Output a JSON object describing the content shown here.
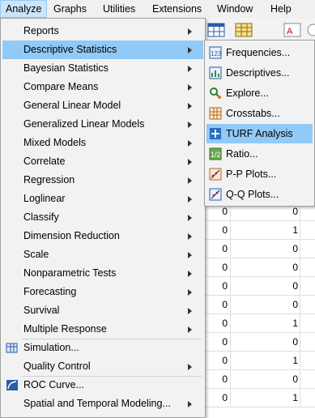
{
  "menubar": {
    "items": [
      {
        "label": "Analyze",
        "active": true
      },
      {
        "label": "Graphs"
      },
      {
        "label": "Utilities"
      },
      {
        "label": "Extensions"
      },
      {
        "label": "Window"
      },
      {
        "label": "Help"
      }
    ]
  },
  "analyze_menu": {
    "items": [
      {
        "label": "Reports",
        "submenu": true
      },
      {
        "label": "Descriptive Statistics",
        "submenu": true,
        "selected": true
      },
      {
        "label": "Bayesian Statistics",
        "submenu": true
      },
      {
        "label": "Compare Means",
        "submenu": true
      },
      {
        "label": "General Linear Model",
        "submenu": true
      },
      {
        "label": "Generalized Linear Models",
        "submenu": true
      },
      {
        "label": "Mixed Models",
        "submenu": true
      },
      {
        "label": "Correlate",
        "submenu": true
      },
      {
        "label": "Regression",
        "submenu": true
      },
      {
        "label": "Loglinear",
        "submenu": true
      },
      {
        "label": "Classify",
        "submenu": true
      },
      {
        "label": "Dimension Reduction",
        "submenu": true
      },
      {
        "label": "Scale",
        "submenu": true
      },
      {
        "label": "Nonparametric Tests",
        "submenu": true
      },
      {
        "label": "Forecasting",
        "submenu": true
      },
      {
        "label": "Survival",
        "submenu": true
      },
      {
        "label": "Multiple Response",
        "submenu": true
      },
      {
        "label": "Simulation...",
        "icon": "simulation-icon"
      },
      {
        "label": "Quality Control",
        "submenu": true
      },
      {
        "label": "ROC Curve...",
        "icon": "roc-curve-icon"
      },
      {
        "label": "Spatial and Temporal Modeling...",
        "submenu": true
      }
    ]
  },
  "descriptive_submenu": {
    "items": [
      {
        "label": "Frequencies...",
        "icon": "frequencies-icon"
      },
      {
        "label": "Descriptives...",
        "icon": "descriptives-icon"
      },
      {
        "label": "Explore...",
        "icon": "explore-icon"
      },
      {
        "label": "Crosstabs...",
        "icon": "crosstabs-icon"
      },
      {
        "label": "TURF Analysis",
        "icon": "turf-analysis-icon",
        "selected": true
      },
      {
        "label": "Ratio...",
        "icon": "ratio-icon"
      },
      {
        "label": "P-P Plots...",
        "icon": "pp-plots-icon"
      },
      {
        "label": "Q-Q Plots...",
        "icon": "qq-plots-icon"
      }
    ]
  },
  "grid": {
    "rows": [
      {
        "a": "",
        "b": "1"
      },
      {
        "a": "0",
        "b": "0"
      },
      {
        "a": "0",
        "b": "0"
      },
      {
        "a": "0",
        "b": "1"
      },
      {
        "a": "0",
        "b": "0"
      },
      {
        "a": "0",
        "b": "0"
      },
      {
        "a": "0",
        "b": "0"
      },
      {
        "a": "0",
        "b": "0"
      },
      {
        "a": "0",
        "b": "1"
      },
      {
        "a": "0",
        "b": "0"
      },
      {
        "a": "0",
        "b": "1"
      },
      {
        "a": "0",
        "b": "0"
      },
      {
        "a": "0",
        "b": "1"
      }
    ]
  },
  "colors": {
    "selection": "#91c9f7",
    "menu_bg": "#f2f2f2",
    "active_menubar": "#cce4f7"
  }
}
